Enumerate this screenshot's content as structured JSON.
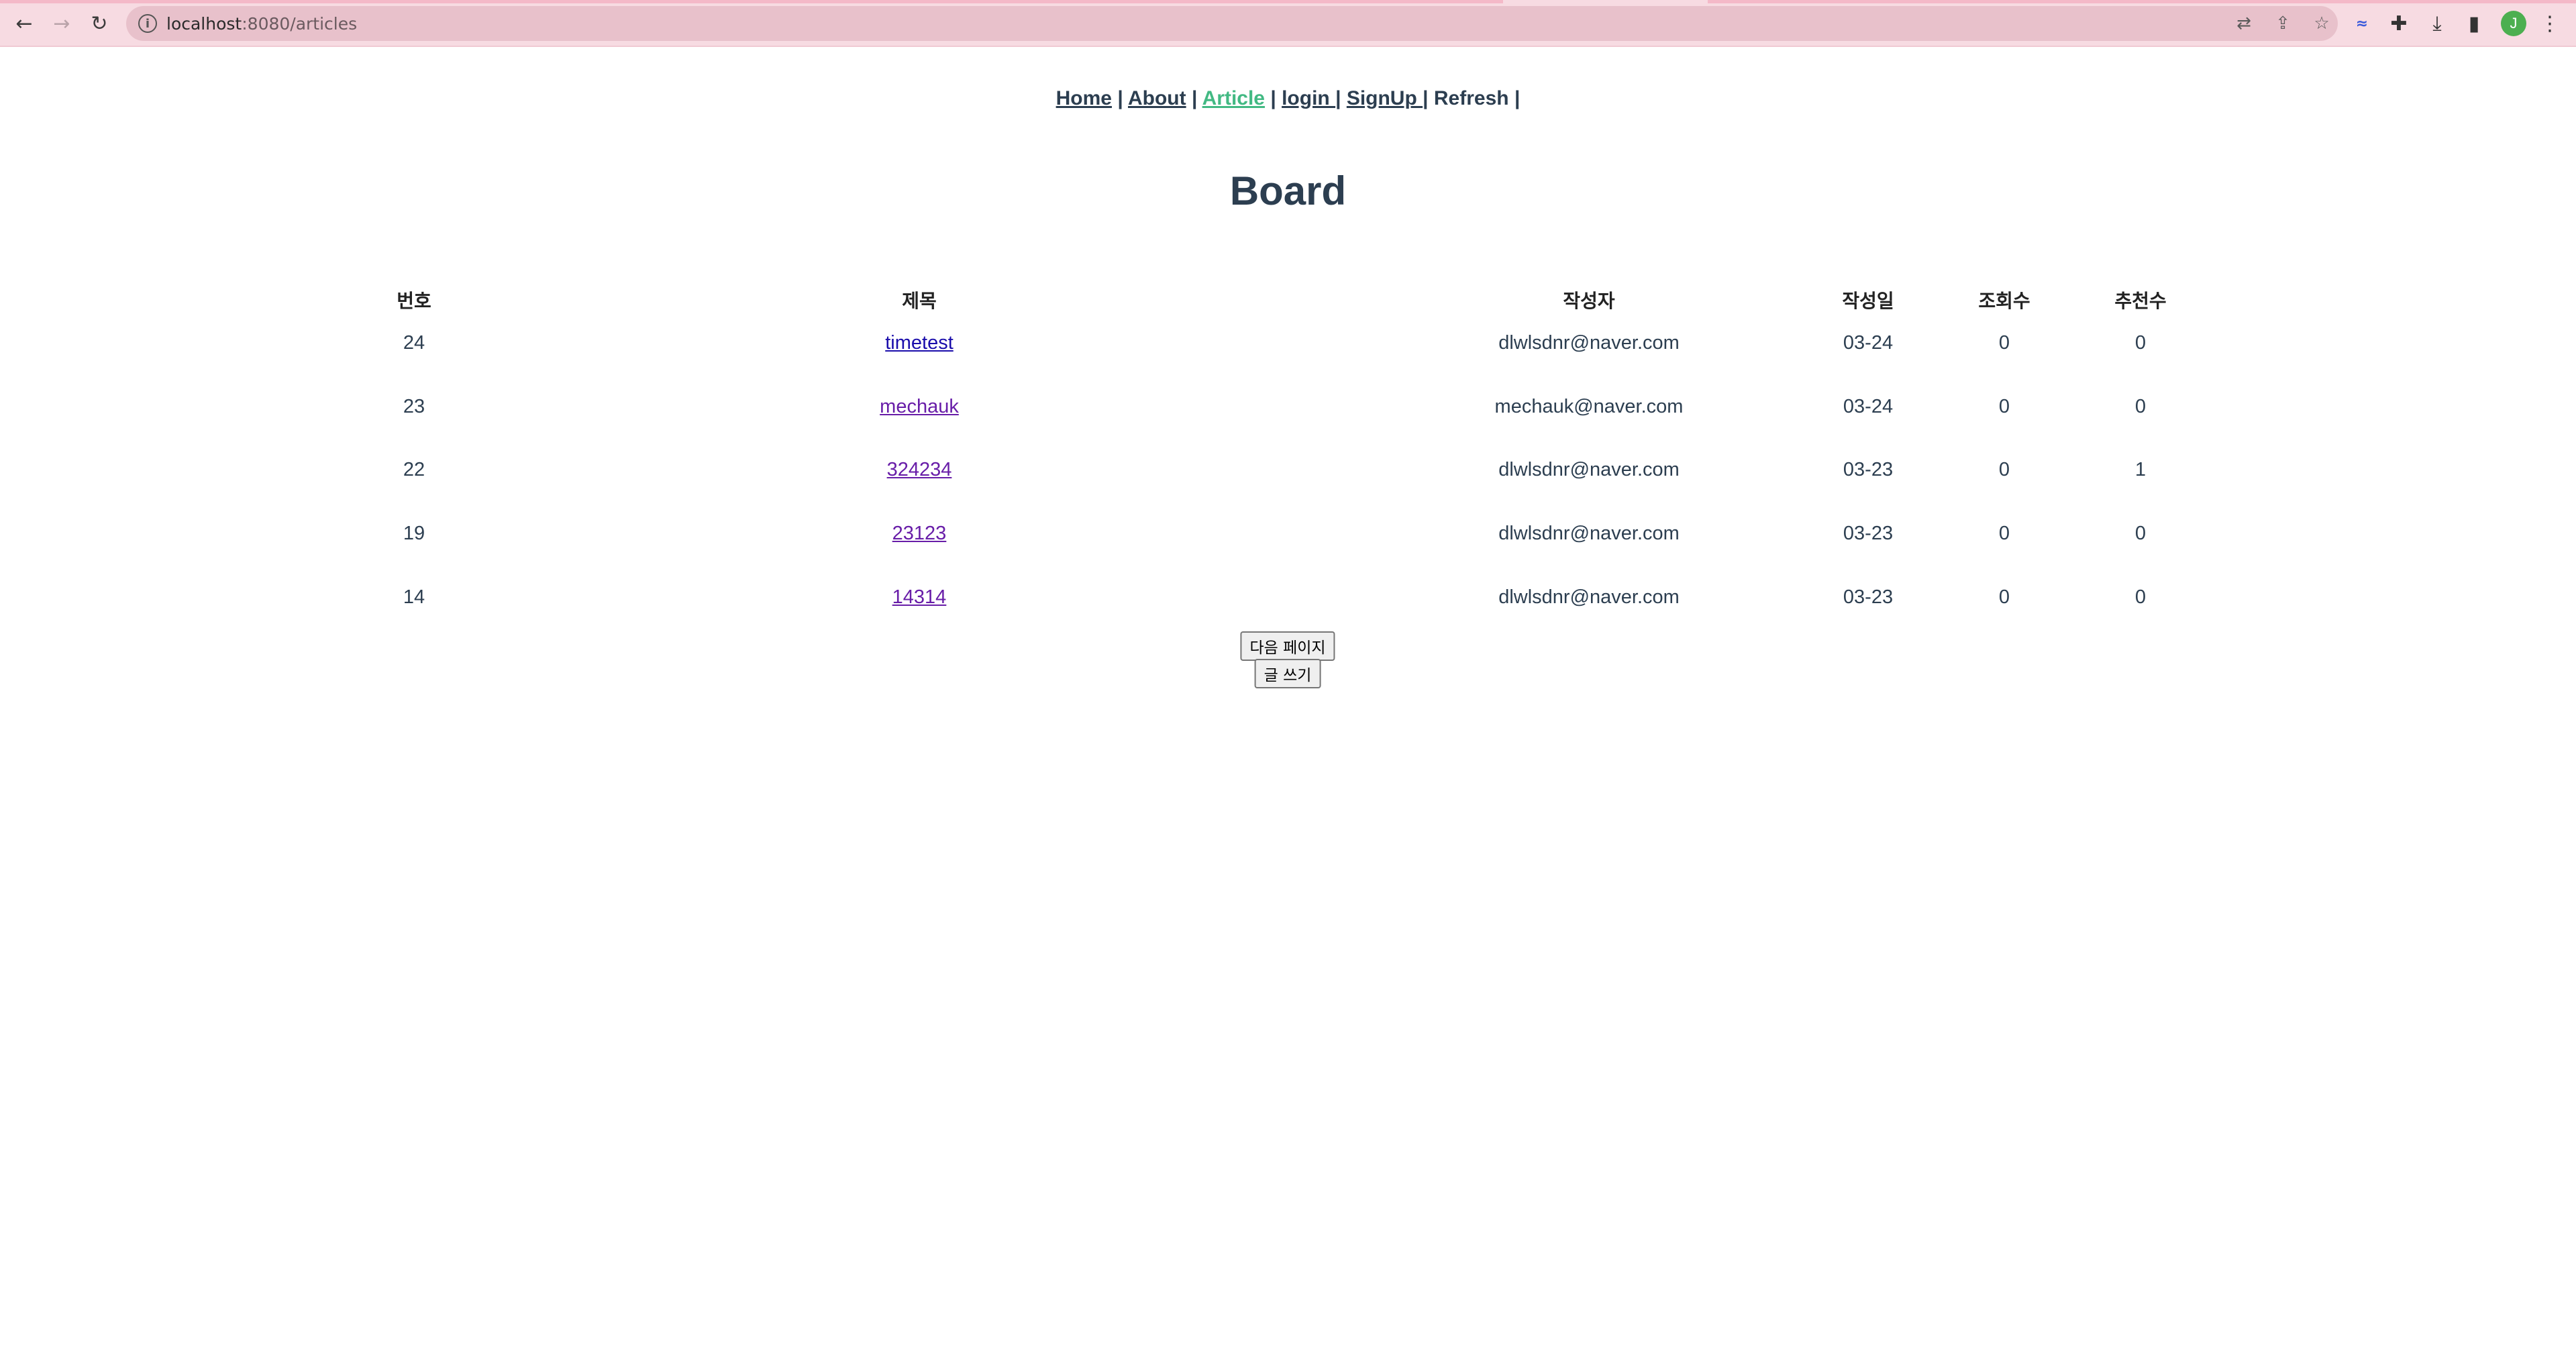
{
  "browser": {
    "url_host": "localhost",
    "url_path": ":8080/articles",
    "profile_initial": "J"
  },
  "nav": {
    "home": "Home",
    "about": "About",
    "article": "Article",
    "login": "login ",
    "signup": " SignUp ",
    "refresh": "Refresh",
    "sep": "|"
  },
  "page": {
    "title": "Board"
  },
  "table": {
    "headers": {
      "no": "번호",
      "title": "제목",
      "author": "작성자",
      "date": "작성일",
      "views": "조회수",
      "likes": "추천수"
    },
    "rows": [
      {
        "no": "24",
        "title": "timetest",
        "author": "dlwlsdnr@naver.com",
        "date": "03-24",
        "views": "0",
        "likes": "0"
      },
      {
        "no": "23",
        "title": "mechauk",
        "author": "mechauk@naver.com",
        "date": "03-24",
        "views": "0",
        "likes": "0"
      },
      {
        "no": "22",
        "title": "324234",
        "author": "dlwlsdnr@naver.com",
        "date": "03-23",
        "views": "0",
        "likes": "1"
      },
      {
        "no": "19",
        "title": "23123",
        "author": "dlwlsdnr@naver.com",
        "date": "03-23",
        "views": "0",
        "likes": "0"
      },
      {
        "no": "14",
        "title": "14314",
        "author": "dlwlsdnr@naver.com",
        "date": "03-23",
        "views": "0",
        "likes": "0"
      }
    ]
  },
  "buttons": {
    "next_page": "다음 페이지",
    "write": "글 쓰기"
  }
}
